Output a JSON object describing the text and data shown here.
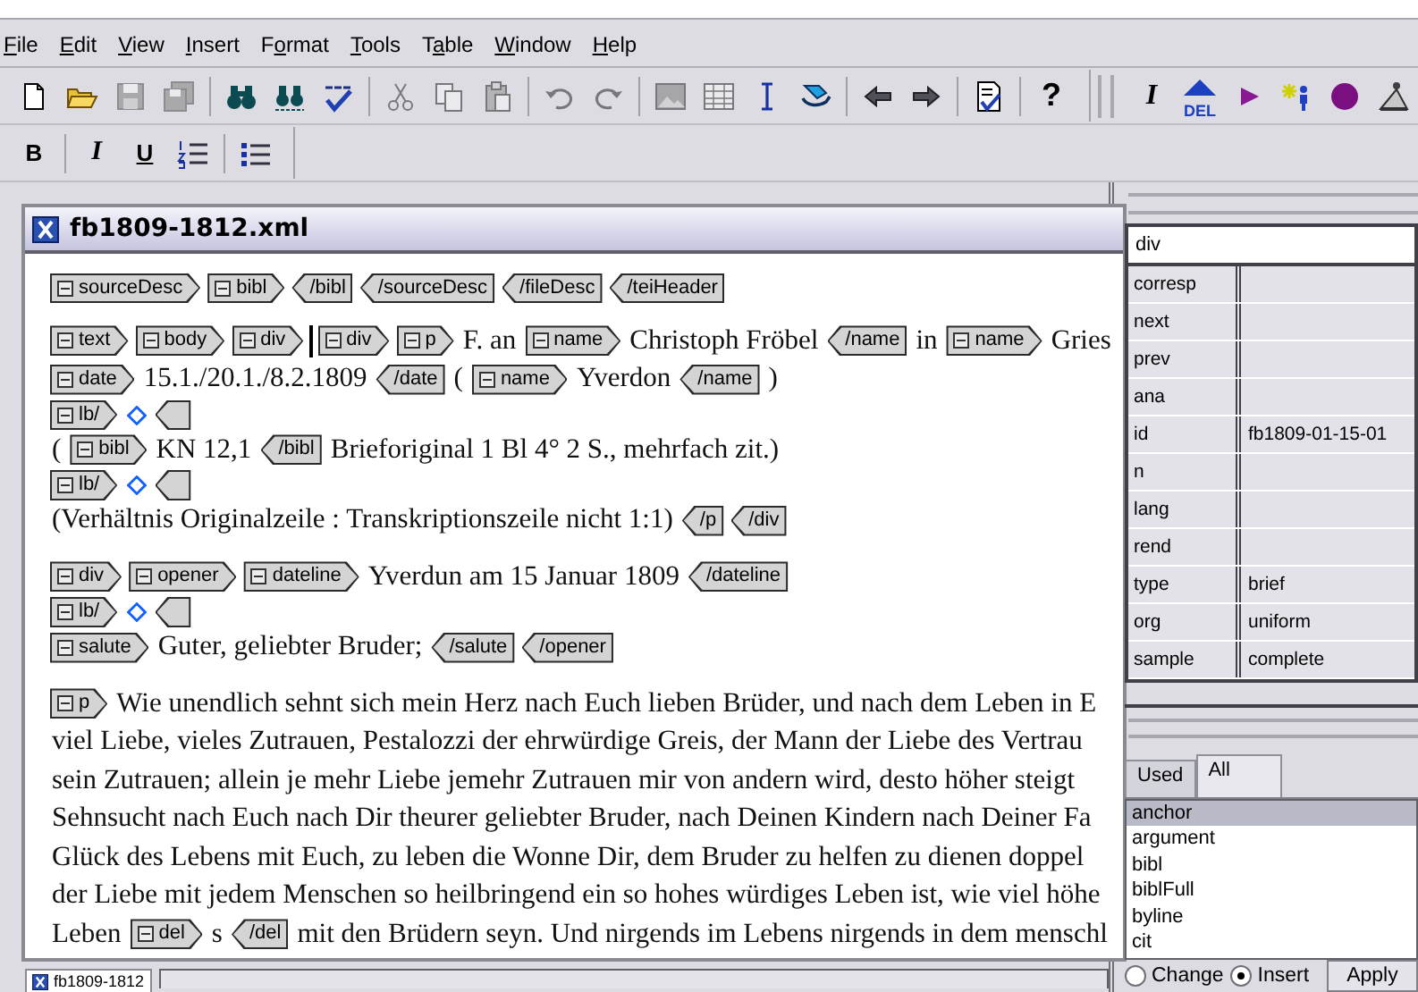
{
  "menu": [
    {
      "key": "F",
      "post": "ile"
    },
    {
      "key": "E",
      "post": "dit"
    },
    {
      "key": "V",
      "post": "iew"
    },
    {
      "key": "I",
      "post": "nsert"
    },
    {
      "pre": "F",
      "key": "o",
      "post": "rmat"
    },
    {
      "key": "T",
      "post": "ools"
    },
    {
      "pre": "T",
      "key": "a",
      "post": "ble"
    },
    {
      "key": "W",
      "post": "indow"
    },
    {
      "key": "H",
      "post": "elp"
    }
  ],
  "toolbar_rows": [
    [
      {
        "groups": [
          [
            {
              "kind": "new",
              "disabled": false
            },
            {
              "kind": "open",
              "disabled": false
            },
            {
              "kind": "save",
              "disabled": true
            },
            {
              "kind": "save-all",
              "disabled": true
            }
          ],
          [
            {
              "kind": "find",
              "disabled": false
            },
            {
              "kind": "find-replace",
              "disabled": false
            },
            {
              "kind": "spellcheck",
              "disabled": false
            }
          ],
          [
            {
              "kind": "cut",
              "disabled": true
            },
            {
              "kind": "copy",
              "disabled": true
            },
            {
              "kind": "paste",
              "disabled": true
            }
          ],
          [
            {
              "kind": "undo",
              "disabled": true
            },
            {
              "kind": "redo",
              "disabled": true
            }
          ],
          [
            {
              "kind": "image",
              "disabled": true
            },
            {
              "kind": "table",
              "disabled": true
            },
            {
              "kind": "ibeam",
              "disabled": false
            },
            {
              "kind": "track",
              "disabled": false
            }
          ],
          [
            {
              "kind": "back",
              "disabled": false
            },
            {
              "kind": "forward",
              "disabled": false
            }
          ],
          [
            {
              "kind": "validate",
              "disabled": false
            }
          ],
          [
            {
              "kind": "help",
              "label": "?",
              "disabled": false
            }
          ]
        ]
      },
      {
        "groups": [
          [
            {
              "kind": "tag-italic",
              "label": "I",
              "disabled": false
            },
            {
              "kind": "del",
              "label": "DEL",
              "disabled": false
            },
            {
              "kind": "play",
              "disabled": false
            },
            {
              "kind": "insert-mark",
              "disabled": false
            },
            {
              "kind": "circle",
              "disabled": false
            },
            {
              "kind": "stamp",
              "disabled": false
            }
          ]
        ]
      }
    ],
    [
      {
        "groups": [
          [
            {
              "kind": "bold",
              "label": "B",
              "disabled": false
            }
          ],
          [
            {
              "kind": "italic",
              "label": "I",
              "disabled": false
            },
            {
              "kind": "underline",
              "label": "U",
              "disabled": false
            },
            {
              "kind": "numbered-list",
              "disabled": false
            }
          ],
          [
            {
              "kind": "bullet-list",
              "disabled": false
            }
          ]
        ]
      }
    ]
  ],
  "document": {
    "title": "fb1809-1812.xml",
    "blocks": [
      {
        "lines": [
          {
            "segments": [
              {
                "kind": "start",
                "tag": "sourceDesc"
              },
              {
                "kind": "start",
                "tag": "bibl"
              },
              {
                "kind": "end",
                "tag": "/bibl"
              },
              {
                "kind": "end",
                "tag": "/sourceDesc"
              },
              {
                "kind": "end",
                "tag": "/fileDesc"
              },
              {
                "kind": "end",
                "tag": "/teiHeader"
              }
            ]
          }
        ]
      },
      {
        "lines": [
          {
            "segments": [
              {
                "kind": "start",
                "tag": "text"
              },
              {
                "kind": "start",
                "tag": "body"
              },
              {
                "kind": "start",
                "tag": "div"
              },
              {
                "kind": "cursor"
              },
              {
                "kind": "start",
                "tag": "div"
              },
              {
                "kind": "start",
                "tag": "p"
              },
              {
                "kind": "text",
                "text": "F. an"
              },
              {
                "kind": "start",
                "tag": "name"
              },
              {
                "kind": "text",
                "text": "Christoph Fröbel"
              },
              {
                "kind": "end",
                "tag": "/name"
              },
              {
                "kind": "text",
                "text": "in"
              },
              {
                "kind": "start",
                "tag": "name"
              },
              {
                "kind": "text",
                "text": "Gries"
              }
            ]
          },
          {
            "segments": [
              {
                "kind": "start",
                "tag": "date"
              },
              {
                "kind": "text",
                "text": "15.1./20.1./8.2.1809"
              },
              {
                "kind": "end",
                "tag": "/date"
              },
              {
                "kind": "text",
                "text": "("
              },
              {
                "kind": "start",
                "tag": "name"
              },
              {
                "kind": "text",
                "text": "Yverdon"
              },
              {
                "kind": "end",
                "tag": "/name"
              },
              {
                "kind": "text",
                "text": ")"
              }
            ]
          },
          {
            "segments": [
              {
                "kind": "start",
                "tag": "lb/"
              },
              {
                "kind": "anchor"
              },
              {
                "kind": "empty-end"
              }
            ]
          },
          {
            "segments": [
              {
                "kind": "text",
                "text": "("
              },
              {
                "kind": "start",
                "tag": "bibl"
              },
              {
                "kind": "text",
                "text": "KN 12,1"
              },
              {
                "kind": "end",
                "tag": "/bibl"
              },
              {
                "kind": "text",
                "text": "Brieforiginal 1 Bl 4° 2 S., mehrfach zit.)"
              }
            ]
          },
          {
            "segments": [
              {
                "kind": "start",
                "tag": "lb/"
              },
              {
                "kind": "anchor"
              },
              {
                "kind": "empty-end"
              }
            ]
          },
          {
            "segments": [
              {
                "kind": "text",
                "text": "(Verhältnis Originalzeile : Transkriptionszeile nicht 1:1)"
              },
              {
                "kind": "end",
                "tag": "/p"
              },
              {
                "kind": "end",
                "tag": "/div"
              }
            ]
          }
        ]
      },
      {
        "lines": [
          {
            "segments": [
              {
                "kind": "start",
                "tag": "div"
              },
              {
                "kind": "start",
                "tag": "opener"
              },
              {
                "kind": "start",
                "tag": "dateline"
              },
              {
                "kind": "text",
                "text": "Yverdun am 15 Januar 1809"
              },
              {
                "kind": "end",
                "tag": "/dateline"
              }
            ]
          },
          {
            "segments": [
              {
                "kind": "start",
                "tag": "lb/"
              },
              {
                "kind": "anchor"
              },
              {
                "kind": "empty-end"
              }
            ]
          },
          {
            "segments": [
              {
                "kind": "start",
                "tag": "salute"
              },
              {
                "kind": "text",
                "text": "Guter, geliebter Bruder;"
              },
              {
                "kind": "end",
                "tag": "/salute"
              },
              {
                "kind": "end",
                "tag": "/opener"
              }
            ]
          }
        ]
      },
      {
        "lines": [
          {
            "segments": [
              {
                "kind": "start",
                "tag": "p"
              },
              {
                "kind": "text",
                "text": "Wie unendlich sehnt sich mein Herz nach Euch lieben Brüder, und nach dem Leben in E"
              }
            ]
          },
          {
            "segments": [
              {
                "kind": "text",
                "text": "viel Liebe, vieles Zutrauen, Pestalozzi der ehrwürdige Greis, der Mann der Liebe des Vertrau"
              }
            ]
          },
          {
            "segments": [
              {
                "kind": "text",
                "text": "sein Zutrauen; allein je mehr Liebe jemehr Zutrauen mir von andern wird, desto höher steigt"
              }
            ]
          },
          {
            "segments": [
              {
                "kind": "text",
                "text": "Sehnsucht nach Euch nach Dir theurer geliebter Bruder, nach Deinen Kindern nach Deiner Fa"
              }
            ]
          },
          {
            "segments": [
              {
                "kind": "text",
                "text": "Glück des Lebens mit Euch, zu leben die Wonne Dir, dem Bruder zu helfen zu dienen doppel"
              }
            ]
          },
          {
            "segments": [
              {
                "kind": "text",
                "text": "der Liebe mit jedem Menschen so heilbringend ein so hohes würdiges Leben ist, wie viel höhe"
              }
            ]
          },
          {
            "segments": [
              {
                "kind": "text",
                "text": "Leben"
              },
              {
                "kind": "start",
                "tag": "del"
              },
              {
                "kind": "text",
                "text": "s"
              },
              {
                "kind": "end",
                "tag": "/del"
              },
              {
                "kind": "text",
                "text": "mit den Brüdern seyn. Und nirgends im Lebens nirgends in dem menschl"
              }
            ]
          }
        ]
      }
    ]
  },
  "taskbar": [
    {
      "label": "fb1809-1812",
      "selected": true
    }
  ],
  "attributes": {
    "element": "div",
    "rows": [
      {
        "name": "corresp"
      },
      {
        "name": "next"
      },
      {
        "name": "prev"
      },
      {
        "name": "ana"
      },
      {
        "name": "id",
        "value": "fb1809-01-15-01"
      },
      {
        "name": "n"
      },
      {
        "name": "lang"
      },
      {
        "name": "rend"
      },
      {
        "name": "type",
        "value": "brief"
      },
      {
        "name": "org",
        "value": "uniform"
      },
      {
        "name": "sample",
        "value": "complete"
      }
    ]
  },
  "element_list": {
    "tabs": [
      {
        "label": "Used",
        "selected": false
      },
      {
        "label": "All",
        "selected": true
      }
    ],
    "items": [
      {
        "label": "anchor",
        "selected": true
      },
      {
        "label": "argument",
        "selected": false
      },
      {
        "label": "bibl",
        "selected": false
      },
      {
        "label": "biblFull",
        "selected": false
      },
      {
        "label": "byline",
        "selected": false
      },
      {
        "label": "cit",
        "selected": false
      }
    ],
    "modes": [
      {
        "label": "Change",
        "selected": false
      },
      {
        "label": "Insert",
        "selected": true
      }
    ],
    "apply": "Apply"
  }
}
